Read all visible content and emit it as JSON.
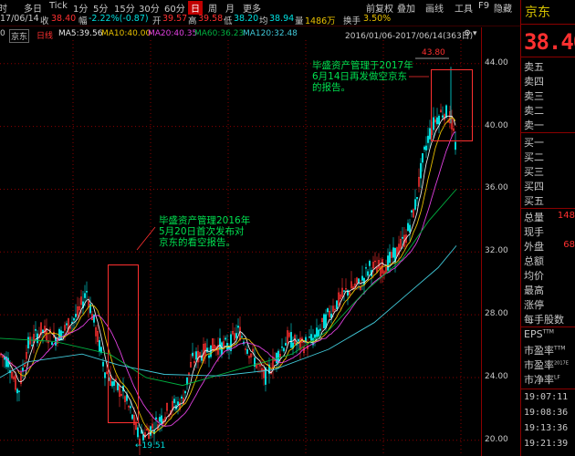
{
  "toolbar": {
    "items": [
      {
        "label": "时"
      },
      {
        "label": "多日"
      },
      {
        "label": "Tick"
      },
      {
        "label": "1分"
      },
      {
        "label": "5分"
      },
      {
        "label": "15分"
      },
      {
        "label": "30分"
      },
      {
        "label": "60分"
      },
      {
        "label": "日"
      },
      {
        "label": "周"
      },
      {
        "label": "月"
      },
      {
        "label": "更多"
      }
    ],
    "right_items": [
      {
        "label": "前复权"
      },
      {
        "label": "叠加"
      },
      {
        "label": "画线"
      },
      {
        "label": "工具"
      },
      {
        "label": "F9"
      },
      {
        "label": "隐藏"
      }
    ]
  },
  "quote_bar": {
    "date": "17/06/14",
    "close_label": "收",
    "close": "38.40",
    "change_label": "幅",
    "change": "-2.22%(-0.87)",
    "open_label": "开",
    "open": "39.57",
    "high_label": "高",
    "high": "39.58",
    "low_label": "低",
    "low": "38.20",
    "avg_label": "均",
    "avg": "38.94",
    "volume_label": "量",
    "volume": "1486万",
    "turnover_label": "换手",
    "turnover": "3.50%"
  },
  "ma_bar": {
    "prefix": "0",
    "code_tag": "京东",
    "period_tag": "日线",
    "ma5": "MA5:39.56",
    "ma10": "MA10:40.00",
    "ma20": "MA20:40.35",
    "ma60": "MA60:36.23",
    "ma120": "MA120:32.48",
    "range": "2016/01/06-2017/06/14(363日)"
  },
  "chart_data": {
    "type": "candlestick",
    "ylim": [
      19,
      45.5
    ],
    "y_ticks": [
      "44.00",
      "40.00",
      "36.00",
      "32.00",
      "28.00",
      "24.00",
      "20.00"
    ],
    "x_range": "2016/01/06-2017/06/14",
    "bars": 363,
    "high_marker": "43.80",
    "low_marker": "19.51",
    "annotations": [
      {
        "text": [
          "毕盛资产管理于2017年",
          "6月14日再发做空京东",
          "的报告。"
        ]
      },
      {
        "text": [
          "毕盛资产管理2016年",
          "5月20日首次发布对",
          "京东的看空报告。"
        ]
      }
    ],
    "colors": {
      "up": "#ff3030",
      "down": "#00e0e0",
      "ma5": "#e8e8e8",
      "ma10": "#e8c000",
      "ma20": "#e040e0",
      "ma60": "#00b040",
      "ma120": "#40c8d8"
    }
  },
  "sidebar": {
    "name": "京东",
    "price": "38.40",
    "order_book": [
      "卖五",
      "卖四",
      "卖三",
      "卖二",
      "卖一",
      "买一",
      "买二",
      "买三",
      "买四",
      "买五"
    ],
    "stats": [
      {
        "label": "总量",
        "value": "148"
      },
      {
        "label": "现手",
        "value": ""
      },
      {
        "label": "外盘",
        "value": "68"
      },
      {
        "label": "总额",
        "value": ""
      },
      {
        "label": "均价",
        "value": ""
      },
      {
        "label": "最高",
        "value": ""
      },
      {
        "label": "涨停",
        "value": ""
      },
      {
        "label": "每手股数",
        "value": ""
      }
    ],
    "fundamentals": [
      {
        "label": "EPS",
        "sup": "TTM"
      },
      {
        "label": "市盈率",
        "sup": "TTM"
      },
      {
        "label": "市盈率",
        "sup": "2017E"
      },
      {
        "label": "市净率",
        "sup": "LF"
      }
    ],
    "ticks": [
      "19:07:11",
      "19:08:36",
      "19:13:36",
      "19:21:39"
    ]
  }
}
